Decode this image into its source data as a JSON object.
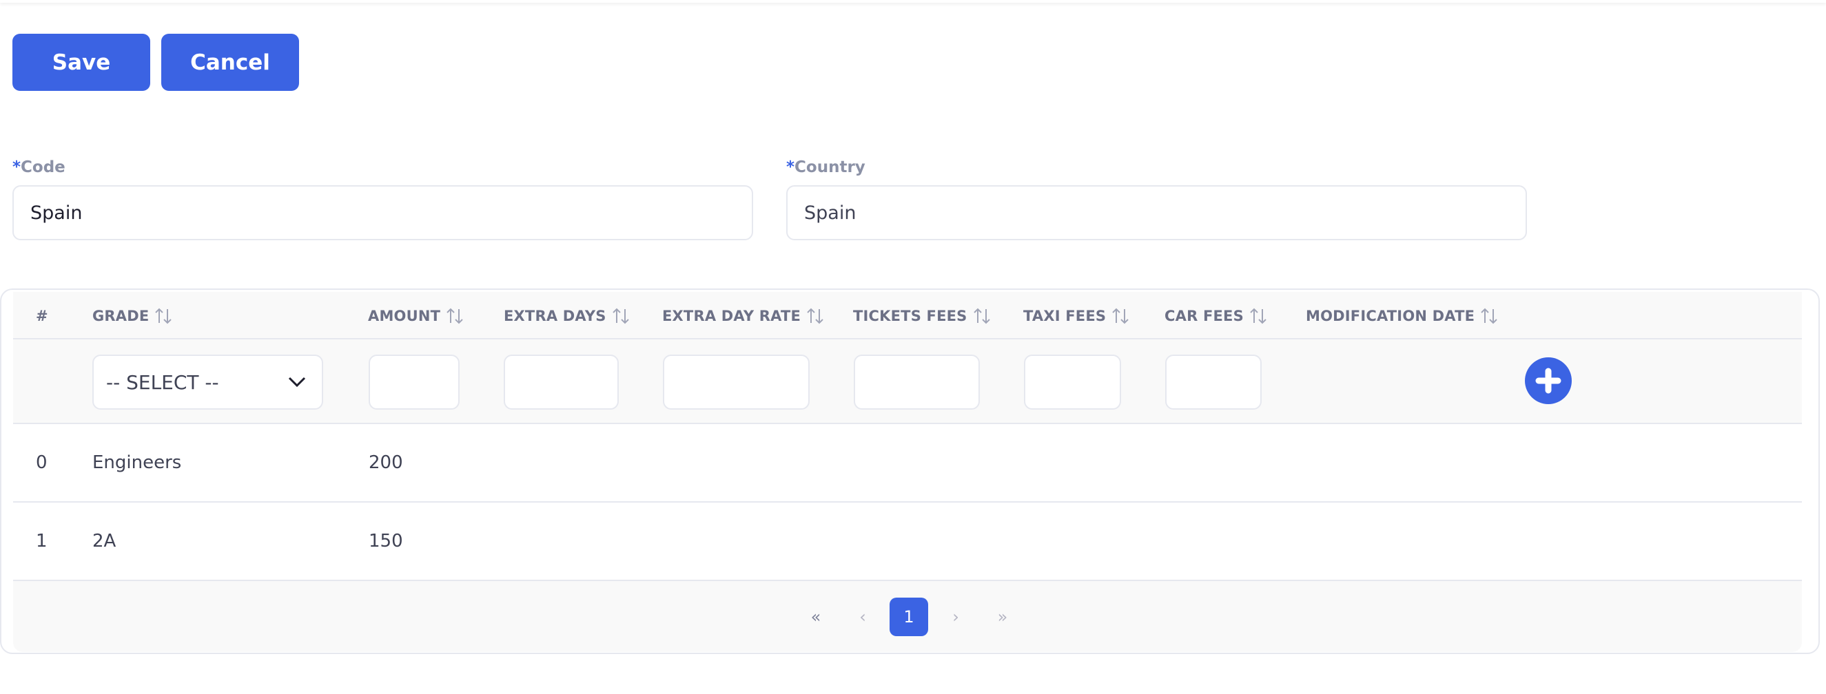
{
  "toolbar": {
    "save_label": "Save",
    "cancel_label": "Cancel"
  },
  "form": {
    "code": {
      "required_mark": "*",
      "label": "Code",
      "value": "Spain"
    },
    "country": {
      "required_mark": "*",
      "label": "Country",
      "value": "Spain"
    }
  },
  "table": {
    "columns": [
      "#",
      "GRADE",
      "AMOUNT",
      "EXTRA DAYS",
      "EXTRA DAY RATE",
      "TICKETS FEES",
      "TAXI FEES",
      "CAR FEES",
      "MODIFICATION DATE"
    ],
    "sort_icon": "sort-arrows-icon",
    "filter": {
      "grade_select_value": "-- SELECT --"
    },
    "rows": [
      {
        "index": "0",
        "grade": "Engineers",
        "amount": "200"
      },
      {
        "index": "1",
        "grade": "2A",
        "amount": "150"
      }
    ]
  },
  "pagination": {
    "first_label": "«",
    "prev_label": "‹",
    "current_page": "1",
    "next_label": "›",
    "last_label": "»"
  },
  "colors": {
    "primary": "#3b63e3",
    "border": "#e6e8ef",
    "header_bg": "#f9f9f9",
    "label": "#8b91a6"
  }
}
